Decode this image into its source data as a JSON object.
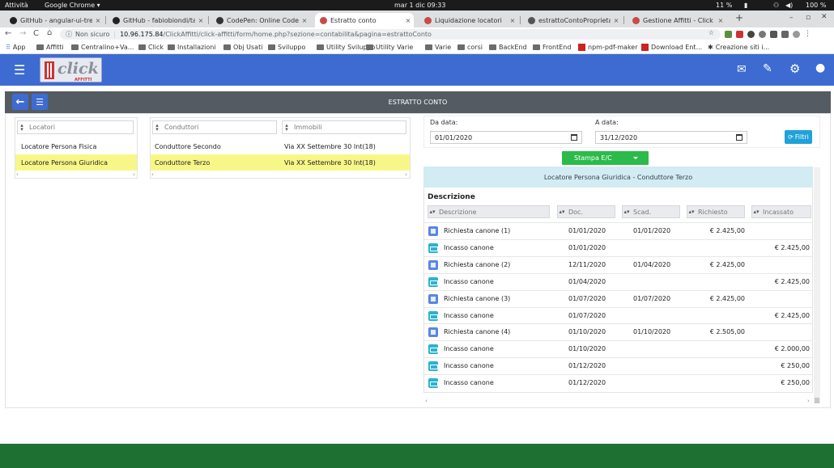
{
  "os": {
    "activities": "Attività",
    "app": "Google Chrome",
    "clock": "mar 1 dic  09:33",
    "cpu": "11 %",
    "battery": "100 %"
  },
  "tabs": [
    {
      "title": "GitHub - angular-ui-tree/a",
      "color": "#222"
    },
    {
      "title": "GitHub - fabiobiondi/talk",
      "color": "#222"
    },
    {
      "title": "CodePen: Online Code Ed",
      "color": "#333"
    },
    {
      "title": "Estratto conto",
      "color": "#c84a4a"
    },
    {
      "title": "Liquidazione locatori",
      "color": "#c84a4a"
    },
    {
      "title": "estrattoContoProprietari",
      "color": "#555"
    },
    {
      "title": "Gestione Affitti - Click srl",
      "color": "#c84a4a"
    }
  ],
  "address": {
    "security": "Non sicuro",
    "url_host": "10.96.175.84",
    "url_path": "/ClickAffitti/click-affitti/form/home.php?sezione=contabilita&pagina=estrattoConto"
  },
  "bookmarks": [
    "App",
    "Affitti",
    "Centralino+Va...",
    "Click",
    "Installazioni",
    "Obj Usati",
    "Sviluppo",
    "Utility Sviluppo",
    "Utility Varie",
    "Varie",
    "corsi",
    "BackEnd",
    "FrontEnd",
    "npm-pdf-maker",
    "Download Ent...",
    "Creazione siti i..."
  ],
  "brand": {
    "logo_text": "click",
    "logo_sub": "AFFITTI",
    "accent": "#3d6bd1"
  },
  "toolbar": {
    "title": "ESTRATTO CONTO"
  },
  "locatori": {
    "placeholder": "Locatori",
    "items": [
      "Locatore Persona Fisica",
      "Locatore Persona Giuridica"
    ]
  },
  "conduttori": {
    "placeholder": "Conduttori",
    "items": [
      "Conduttore Secondo",
      "Conduttore Terzo"
    ]
  },
  "immobili": {
    "placeholder": "Immobili",
    "items": [
      "Via XX Settembre 30 Int(18)",
      "Via XX Settembre 30 Int(18)"
    ]
  },
  "dates": {
    "from_label": "Da data:",
    "from_value": "01/01/2020",
    "to_label": "A data:",
    "to_value": "31/12/2020"
  },
  "filtri_label": "Filtri",
  "stampa_label": "Stampa E/C",
  "estratto": {
    "title": "Locatore Persona Giuridica - Conduttore Terzo",
    "section": "Descrizione",
    "columns": [
      "Descrizione",
      "Doc.",
      "Scad.",
      "Richiesto",
      "Incassato"
    ],
    "rows": [
      {
        "type": "doc",
        "desc": "Richiesta canone (1)",
        "doc": "01/01/2020",
        "scad": "01/01/2020",
        "rich": "€ 2.425,00",
        "inc": ""
      },
      {
        "type": "cash",
        "desc": "Incasso canone",
        "doc": "01/01/2020",
        "scad": "",
        "rich": "",
        "inc": "€ 2.425,00"
      },
      {
        "type": "doc",
        "desc": "Richiesta canone (2)",
        "doc": "12/11/2020",
        "scad": "01/04/2020",
        "rich": "€ 2.425,00",
        "inc": ""
      },
      {
        "type": "cash",
        "desc": "Incasso canone",
        "doc": "01/04/2020",
        "scad": "",
        "rich": "",
        "inc": "€ 2.425,00"
      },
      {
        "type": "doc",
        "desc": "Richiesta canone (3)",
        "doc": "01/07/2020",
        "scad": "01/07/2020",
        "rich": "€ 2.425,00",
        "inc": ""
      },
      {
        "type": "cash",
        "desc": "Incasso canone",
        "doc": "01/07/2020",
        "scad": "",
        "rich": "",
        "inc": "€ 2.425,00"
      },
      {
        "type": "doc",
        "desc": "Richiesta canone (4)",
        "doc": "01/10/2020",
        "scad": "01/10/2020",
        "rich": "€ 2.505,00",
        "inc": ""
      },
      {
        "type": "cash",
        "desc": "Incasso canone",
        "doc": "01/10/2020",
        "scad": "",
        "rich": "",
        "inc": "€ 2.000,00"
      },
      {
        "type": "cash",
        "desc": "Incasso canone",
        "doc": "01/12/2020",
        "scad": "",
        "rich": "",
        "inc": "€ 250,00"
      },
      {
        "type": "cash",
        "desc": "Incasso canone",
        "doc": "01/12/2020",
        "scad": "",
        "rich": "",
        "inc": "€ 250,00"
      }
    ]
  }
}
